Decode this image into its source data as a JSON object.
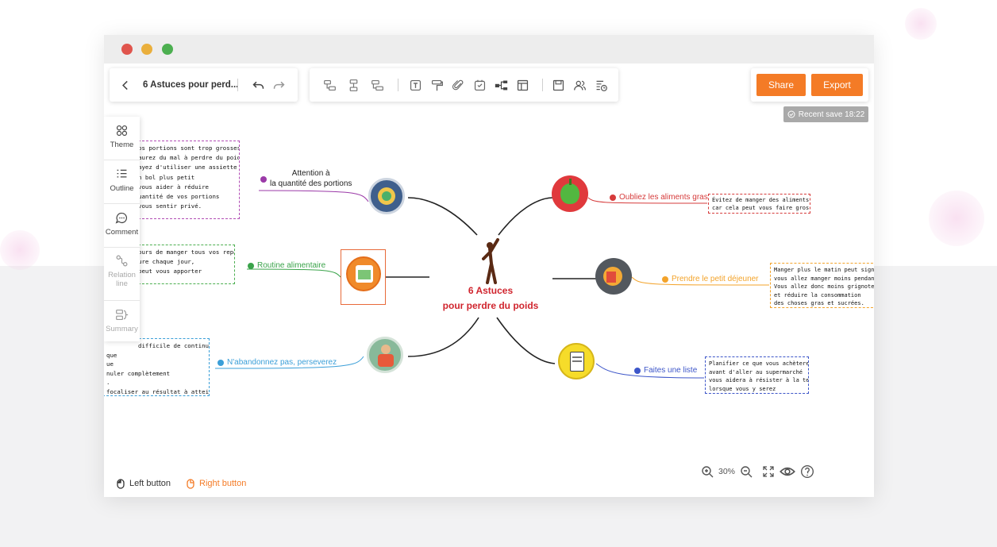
{
  "toolbar": {
    "doc_title": "6 Astuces  pour perd...",
    "share_label": "Share",
    "export_label": "Export",
    "recent_save": "Recent save 18:22"
  },
  "sidebar": {
    "items": [
      {
        "label": "Theme",
        "icon": "theme-icon"
      },
      {
        "label": "Outline",
        "icon": "outline-icon"
      },
      {
        "label": "Comment",
        "icon": "comment-icon"
      },
      {
        "label": "Relation line",
        "icon": "relation-line-icon"
      },
      {
        "label": "Summary",
        "icon": "summary-icon"
      }
    ]
  },
  "mindmap": {
    "central": {
      "line1": "6 Astuces",
      "line2": "pour perdre du poids"
    },
    "branches": [
      {
        "label_line1": "Attention à",
        "label_line2": "la quantité des portions",
        "color": "#9b3aa8",
        "note": [
          "os portions sont trop grosses,",
          "aurez du mal à perdre du poids.",
          "ayez d'utiliser une assiette",
          "n bol plus petit",
          "vous aider à réduire",
          "uantité de vos portions",
          "vous sentir privé."
        ]
      },
      {
        "label": "Routine alimentaire",
        "color": "#3aa34a",
        "note": [
          "ours de manger tous vos repas",
          "ure chaque jour,",
          "peut vous apporter"
        ]
      },
      {
        "label": "N'abandonnez pas, perseverez",
        "color": "#3b9fd8",
        "note": [
          "difficile de continuer,",
          "que",
          "ue",
          "nuler complètement",
          ".",
          "focaliser au résultat à atteindre."
        ]
      },
      {
        "label": "Oubliez les aliments gras",
        "color": "#d63b3b",
        "note": [
          "Évitez de manger des aliments gras",
          "car cela peut vous faire grossir"
        ]
      },
      {
        "label": "Prendre le petit déjeuner",
        "color": "#f3a32a",
        "note": [
          "Manger plus le matin peut signifier qu",
          "vous allez manger moins pendant la jo",
          "Vous allez donc moins grignoter",
          "et réduire la consommation",
          "des choses gras et sucrées."
        ]
      },
      {
        "label": "Faites une liste",
        "color": "#3d56c9",
        "note": [
          "Planifier ce que vous achèterez",
          "avant d'aller au supermarché",
          "vous aidera à résister à la tentation",
          "lorsque vous y serez"
        ]
      }
    ]
  },
  "status_bar": {
    "left_button": "Left button",
    "right_button": "Right button",
    "zoom_level": "30%"
  },
  "colors": {
    "accent": "#f47b26",
    "central_text": "#d0252e"
  }
}
